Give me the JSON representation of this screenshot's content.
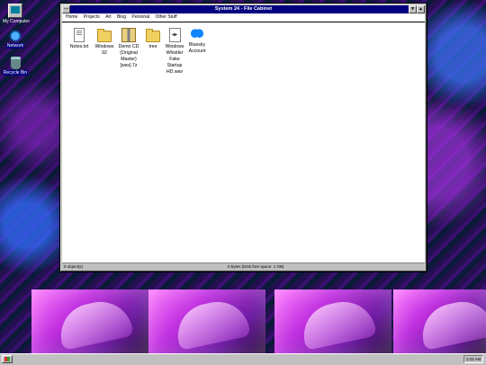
{
  "desktop": {
    "icons": [
      {
        "label": "My Computer",
        "icon": "computer-icon"
      },
      {
        "label": "Network",
        "icon": "network-icon"
      },
      {
        "label": "Recycle Bin",
        "icon": "recycle-bin-icon"
      }
    ]
  },
  "window": {
    "title": "System 24 - File Cabinet",
    "menu": [
      "Home",
      "Projects",
      "Art",
      "Blog",
      "Personal",
      "Other Stuff"
    ],
    "files": [
      {
        "label": "Notes.txt",
        "icon": "text-file-icon"
      },
      {
        "label": "Windows 92",
        "icon": "folder-icon"
      },
      {
        "label": "Demo CD (Original Master) [wav].7z",
        "icon": "archive-icon"
      },
      {
        "label": "tree",
        "icon": "folder-icon"
      },
      {
        "label": "Windows Whistler Fake Startup HD.wav",
        "icon": "audio-file-icon"
      },
      {
        "label": "Bluesky Account",
        "icon": "bluesky-icon"
      }
    ],
    "status_left": "0 object(s)",
    "status_right": "0 bytes (Disk free space: 1 GB)"
  },
  "taskbar": {
    "clock": "1:03 AM"
  },
  "colors": {
    "titlebar": "#000080",
    "chrome": "#c0c0c0",
    "bluesky": "#1185fe"
  }
}
